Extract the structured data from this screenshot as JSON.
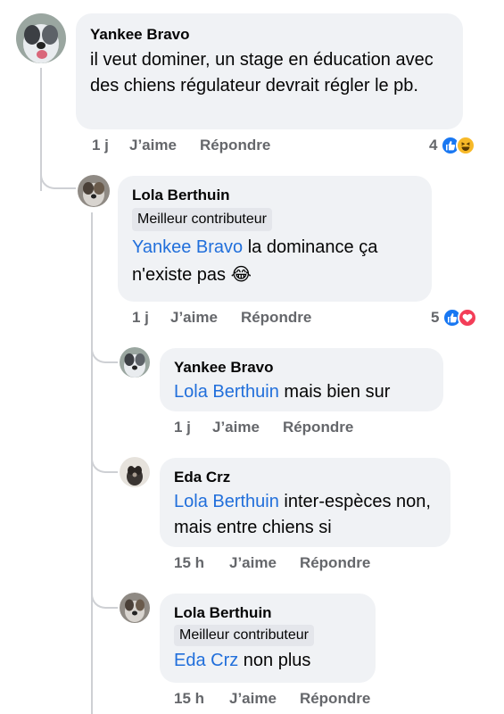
{
  "comments": [
    {
      "author": "Yankee Bravo",
      "text": "il veut dominer, un stage en éducation avec des chiens régulateur devrait régler le pb.",
      "time": "1 j",
      "like": "J’aime",
      "reply": "Répondre",
      "reaction_count": "4",
      "reactions": [
        "like-icon",
        "haha-icon"
      ]
    },
    {
      "author": "Lola Berthuin",
      "badge": "Meilleur contributeur",
      "mention": "Yankee Bravo",
      "text": " la dominance ça n'existe pas",
      "emoji": "😂",
      "time": "1 j",
      "like": "J’aime",
      "reply": "Répondre",
      "reaction_count": "5",
      "reactions": [
        "like-icon",
        "love-icon"
      ]
    },
    {
      "author": "Yankee Bravo",
      "mention": "Lola Berthuin",
      "text": " mais bien sur",
      "time": "1 j",
      "like": "J’aime",
      "reply": "Répondre"
    },
    {
      "author": "Eda Crz",
      "mention": "Lola Berthuin",
      "text": " inter-espèces non, mais entre chiens si",
      "time": "15 h",
      "like": "J’aime",
      "reply": "Répondre"
    },
    {
      "author": "Lola Berthuin",
      "badge": "Meilleur contributeur",
      "mention": "Eda Crz",
      "text": " non plus",
      "time": "15 h",
      "like": "J’aime",
      "reply": "Répondre"
    }
  ],
  "colors": {
    "bubble": "#f0f2f5",
    "mention": "#216fdb",
    "meta": "#65676b",
    "like": "#1877f2",
    "love": "#f33e58",
    "haha": "#f7b928"
  }
}
